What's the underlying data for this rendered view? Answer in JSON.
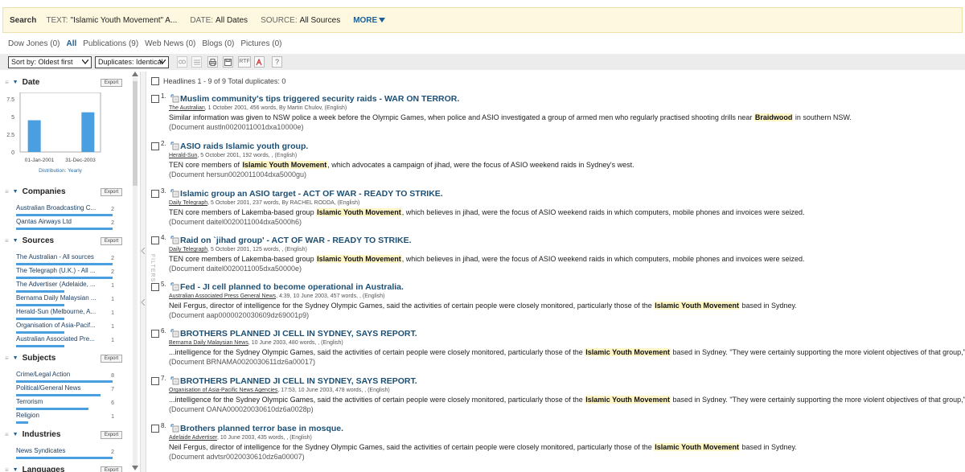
{
  "search": {
    "label": "Search",
    "text_key": "TEXT:",
    "text_val": "\"Islamic Youth Movement\" A...",
    "date_key": "DATE:",
    "date_val": "All Dates",
    "source_key": "SOURCE:",
    "source_val": "All Sources",
    "more": "MORE"
  },
  "content_tabs": [
    "Dow Jones (0)",
    "All",
    "Publications (9)",
    "Web News (0)",
    "Blogs (0)",
    "Pictures (0)"
  ],
  "toolbar": {
    "sort_value": "Sort by: Oldest first",
    "duplicates_value": "Duplicates: Identical",
    "rtf_label": "RTF",
    "help_label": "?"
  },
  "left_panel": {
    "export_label": "Export",
    "date_section": {
      "title": "Date",
      "y_ticks": [
        "7.5",
        "5",
        "2.5",
        "0"
      ],
      "x_ticks": [
        "01-Jan-2001",
        "31-Dec-2003"
      ],
      "distribution": "Distribution: Yearly"
    },
    "companies": {
      "title": "Companies",
      "items": [
        {
          "label": "Australian Broadcasting C...",
          "count": "2"
        },
        {
          "label": "Qantas Airways Ltd",
          "count": "2"
        }
      ]
    },
    "sources": {
      "title": "Sources",
      "items": [
        {
          "label": "The Australian - All sources",
          "count": "2"
        },
        {
          "label": "The Telegraph (U.K.) - All ...",
          "count": "2"
        },
        {
          "label": "The Advertiser (Adelaide, ...",
          "count": "1"
        },
        {
          "label": "Bernama Daily Malaysian ...",
          "count": "1"
        },
        {
          "label": "Herald-Sun (Melbourne, A...",
          "count": "1"
        },
        {
          "label": "Organisation of Asia-Pacif...",
          "count": "1"
        },
        {
          "label": "Australian Associated Pre...",
          "count": "1"
        }
      ]
    },
    "subjects": {
      "title": "Subjects",
      "items": [
        {
          "label": "Crime/Legal Action",
          "count": "8"
        },
        {
          "label": "Political/General News",
          "count": "7"
        },
        {
          "label": "Terrorism",
          "count": "6"
        },
        {
          "label": "Religion",
          "count": "1"
        }
      ]
    },
    "industries": {
      "title": "Industries",
      "items": [
        {
          "label": "News Syndicates",
          "count": "2"
        }
      ]
    },
    "languages": {
      "title": "Languages"
    }
  },
  "chart_data": {
    "type": "bar",
    "categories": [
      "2001",
      "2002",
      "2003"
    ],
    "values": [
      4,
      0,
      5
    ],
    "ylim": [
      0,
      7.5
    ],
    "x_tick_labels": [
      "01-Jan-2001",
      "31-Dec-2003"
    ],
    "title": "",
    "xlabel": "Distribution: Yearly",
    "ylabel": "",
    "color": "#4a9fe0"
  },
  "filters_label": "FILTERS",
  "headlines_summary": "Headlines 1 - 9 of 9 Total duplicates: 0",
  "articles": [
    {
      "num": "1.",
      "title": "Muslim community's tips triggered security raids - WAR ON TERROR.",
      "source": "The Australian",
      "meta": ", 1 October 2001, 456 words, By Martin Chulov, (English)",
      "pre": "Similar information was given to NSW police a week before the Olympic Games, when police and ASIO investigated a group of armed men who regularly practised shooting drills near ",
      "hl": "Braidwood",
      "post": " in southern NSW.",
      "doc": "(Document austln0020011001dxa10000e)"
    },
    {
      "num": "2.",
      "title": "ASIO raids Islamic youth group.",
      "source": "Herald-Sun",
      "meta": ", 5 October 2001, 192 words, , (English)",
      "pre": "TEN core members of ",
      "hl": "Islamic Youth Movement",
      "post": ", which advocates a campaign of jihad, were the focus of ASIO weekend raids in Sydney's west.",
      "doc": "(Document hersun0020011004dxa5000gu)"
    },
    {
      "num": "3.",
      "title": "Islamic group an ASIO target - ACT OF WAR - READY TO STRIKE.",
      "source": "Daily Telegraph",
      "meta": ", 5 October 2001, 237 words, By RACHEL RODDA, (English)",
      "pre": "TEN core members of Lakemba-based group ",
      "hl": "Islamic Youth Movement",
      "post": ", which believes in jihad, were the focus of ASIO weekend raids in which computers, mobile phones and invoices were seized.",
      "doc": "(Document daitel0020011004dxa5000h6)"
    },
    {
      "num": "4.",
      "title": "Raid on `jihad group' - ACT OF WAR - READY TO STRIKE.",
      "source": "Daily Telegraph",
      "meta": ", 5 October 2001, 125 words, , (English)",
      "pre": "TEN core members of Lakemba-based group ",
      "hl": "Islamic Youth Movement",
      "post": ", which believes in jihad, were the focus of ASIO weekend raids in which computers, mobile phones and invoices were seized.",
      "doc": "(Document daitel0020011005dxa50000e)"
    },
    {
      "num": "5.",
      "title": "Fed - JI cell planned to become operational in Australia.",
      "source": "Australian Associated Press General News",
      "meta": ", 4:39, 10 June 2003, 457 words, , (English)",
      "pre": "Neil Fergus, director of intelligence for the Sydney Olympic Games, said the activities of certain people were closely monitored, particularly those of the ",
      "hl": "Islamic Youth Movement",
      "post": " based in Sydney.",
      "doc": "(Document aap0000020030609dz69001p9)"
    },
    {
      "num": "6.",
      "title": "BROTHERS PLANNED JI CELL IN SYDNEY, SAYS REPORT.",
      "source": "Bernama Daily Malaysian News",
      "meta": ", 10 June 2003, 480 words, , (English)",
      "pre": "...intelligence for the Sydney Olympic Games, said the activities of certain people were closely monitored, particularly those of the ",
      "hl": "Islamic Youth Movement",
      "post": " based in Sydney. \"They were certainly supporting the more violent objectives of that group,\"",
      "doc": "(Document BRNAMA0020030611dz6a00017)"
    },
    {
      "num": "7.",
      "title": "BROTHERS PLANNED JI CELL IN SYDNEY, SAYS REPORT.",
      "source": "Organisation of Asia-Pacific News Agencies",
      "meta": ", 17:53, 10 June 2003, 478 words, , (English)",
      "pre": "...intelligence for the Sydney Olympic Games, said the activities of certain people were closely monitored, particularly those of the ",
      "hl": "Islamic Youth Movement",
      "post": " based in Sydney. \"They were certainly supporting the more violent objectives of that group,\"",
      "doc": "(Document OANA000020030610dz6a0028p)"
    },
    {
      "num": "8.",
      "title": "Brothers planned terror base in mosque.",
      "source": "Adelaide Advertiser",
      "meta": ", 10 June 2003, 435 words, , (English)",
      "pre": "Neil Fergus, director of intelligence for the Sydney Olympic Games, said the activities of certain people were closely monitored, particularly those of the ",
      "hl": "Islamic Youth Movement",
      "post": " based in Sydney.",
      "doc": "(Document advtsr0020030610dz6a00007)"
    }
  ]
}
